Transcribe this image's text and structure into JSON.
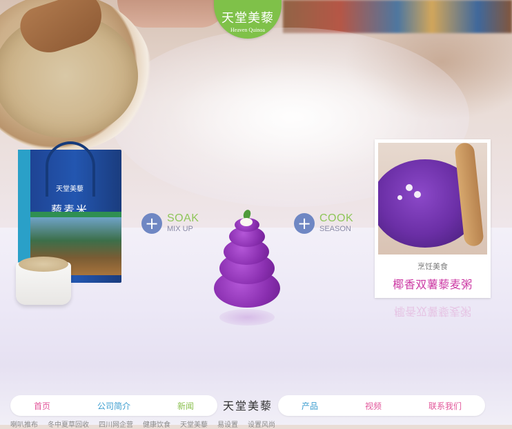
{
  "logo": {
    "cn": "天堂美藜",
    "en": "Heaven Quinoa"
  },
  "product_box": {
    "brand": "天堂美藜",
    "name": "藜麦米"
  },
  "steps": [
    {
      "main": "SOAK",
      "sub": "MIX UP"
    },
    {
      "main": "COOK",
      "sub": "SEASON"
    }
  ],
  "recipe_card": {
    "caption": "烹饪美食",
    "title": "椰香双薯藜麦粥"
  },
  "nav": {
    "brand": "天堂美藜",
    "left_items": [
      {
        "label": "首页",
        "color": "#e2569a"
      },
      {
        "label": "公司简介",
        "color": "#3a9ccf"
      },
      {
        "label": "新闻",
        "color": "#8cc151"
      }
    ],
    "right_items": [
      {
        "label": "产品",
        "color": "#3a9ccf"
      },
      {
        "label": "视频",
        "color": "#e2569a"
      },
      {
        "label": "联系我们",
        "color": "#e2569a"
      }
    ]
  },
  "footer_links": [
    "喇叭推布",
    "冬中夏草回收",
    "四川网企营",
    "健康饮食",
    "天堂美藜",
    "易设置",
    "设置风尚"
  ],
  "colors": {
    "accent_green": "#8fc65a",
    "accent_purple": "#8a2fb0",
    "title_pink": "#cc3aa4",
    "plus_blue": "#6f87c3"
  }
}
